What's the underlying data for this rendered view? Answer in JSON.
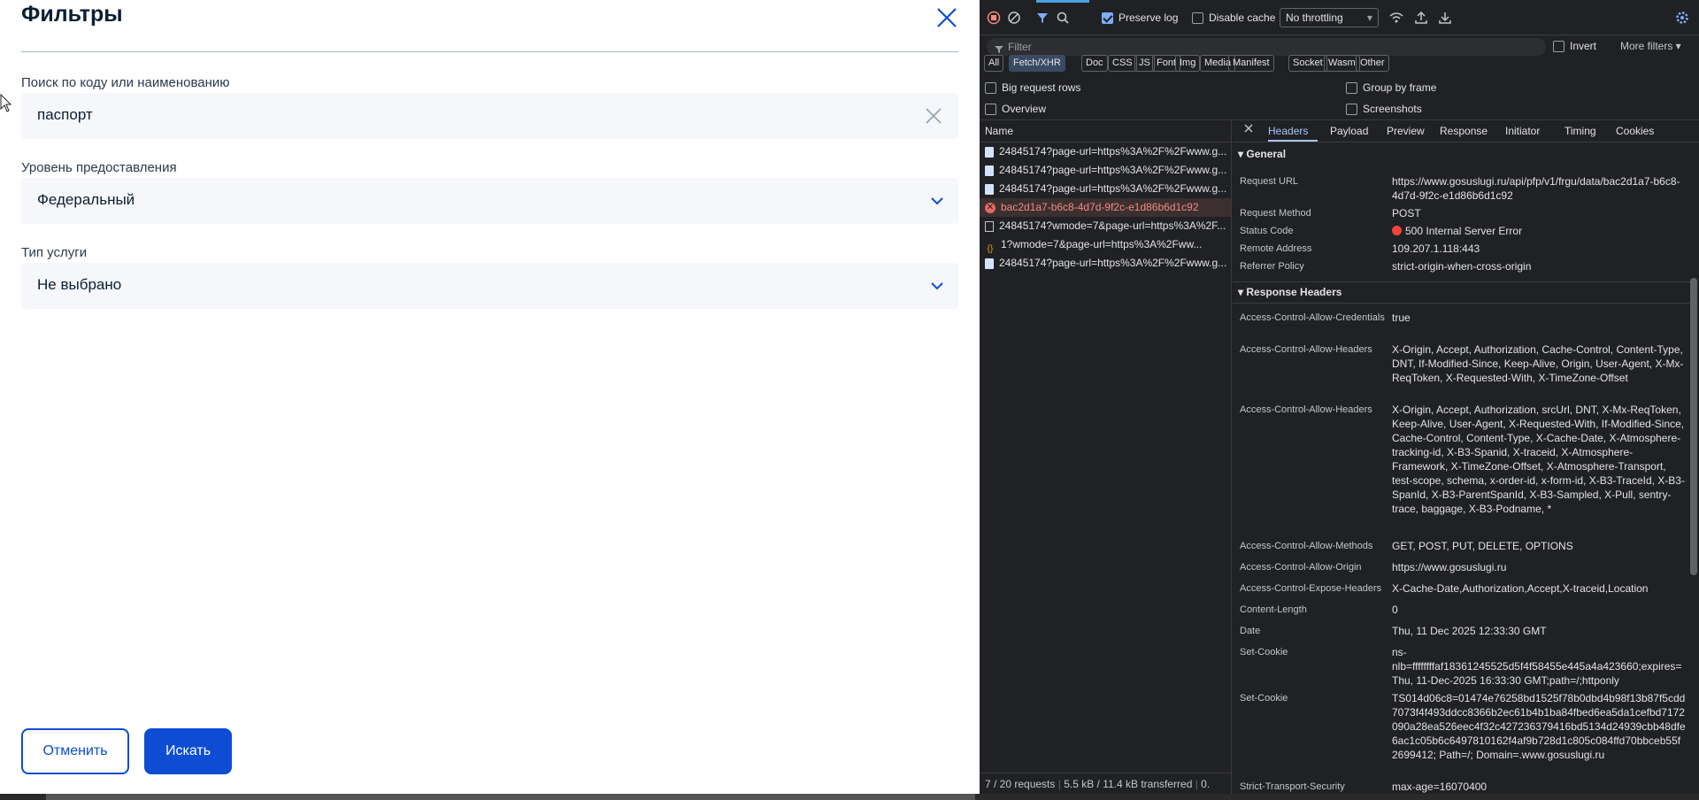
{
  "filter_panel": {
    "title": "Фильтры",
    "search": {
      "label": "Поиск по коду или наименованию",
      "value": "паспорт"
    },
    "level": {
      "label": "Уровень предоставления",
      "value": "Федеральный"
    },
    "service_type": {
      "label": "Тип услуги",
      "value": "Не выбрано"
    },
    "cancel_label": "Отменить",
    "search_label": "Искать"
  },
  "devtools": {
    "toolbar": {
      "preserve_log": "Preserve log",
      "disable_cache": "Disable cache",
      "throttling": "No throttling"
    },
    "filter": {
      "placeholder": "Filter",
      "invert": "Invert",
      "more_filters": "More filters"
    },
    "types": [
      "All",
      "Fetch/XHR",
      "Doc",
      "CSS",
      "JS",
      "Font",
      "Img",
      "Media",
      "Manifest",
      "Socket",
      "Wasm",
      "Other"
    ],
    "active_type": "Fetch/XHR",
    "options": {
      "big_rows": "Big request rows",
      "group_by_frame": "Group by frame",
      "overview": "Overview",
      "screenshots": "Screenshots"
    },
    "names_header": "Name",
    "requests": [
      {
        "name": "24845174?page-url=https%3A%2F%2Fwww.g...",
        "icon": "doc-icon"
      },
      {
        "name": "24845174?page-url=https%3A%2F%2Fwww.g...",
        "icon": "doc-icon"
      },
      {
        "name": "24845174?page-url=https%3A%2F%2Fwww.g...",
        "icon": "doc-icon"
      },
      {
        "name": "bac2d1a7-b6c8-4d7d-9f2c-e1d86b6d1c92",
        "icon": "error-icon"
      },
      {
        "name": "24845174?wmode=7&page-url=https%3A%2F...",
        "icon": "file-icon"
      },
      {
        "name": "1?wmode=7&page-url=https%3A%2Fww...",
        "icon": "script-icon"
      },
      {
        "name": "24845174?page-url=https%3A%2F%2Fwww.g...",
        "icon": "doc-icon"
      }
    ],
    "footer": {
      "requests": "7 / 20 requests",
      "transferred": "5.5 kB / 11.4 kB transferred",
      "extra": "0."
    },
    "tabs": [
      "Headers",
      "Payload",
      "Preview",
      "Response",
      "Initiator",
      "Timing",
      "Cookies"
    ],
    "general_title": "General",
    "general": [
      {
        "key": "Request URL",
        "value": "https://www.gosuslugi.ru/api/pfp/v1/frgu/data/bac2d1a7-b6c8-4d7d-9f2c-e1d86b6d1c92"
      },
      {
        "key": "Request Method",
        "value": "POST"
      },
      {
        "key": "Status Code",
        "value": "500 Internal Server Error"
      },
      {
        "key": "Remote Address",
        "value": "109.207.1.118:443"
      },
      {
        "key": "Referrer Policy",
        "value": "strict-origin-when-cross-origin"
      }
    ],
    "response_title": "Response Headers",
    "response": [
      {
        "key": "Access-Control-Allow-Credentials",
        "value": "true"
      },
      {
        "key": "Access-Control-Allow-Headers",
        "value": "X-Origin, Accept, Authorization, Cache-Control, Content-Type, DNT, If-Modified-Since, Keep-Alive, Origin, User-Agent, X-Mx-ReqToken, X-Requested-With, X-TimeZone-Offset"
      },
      {
        "key": "Access-Control-Allow-Headers",
        "value": "X-Origin, Accept, Authorization, srcUrl, DNT, X-Mx-ReqToken, Keep-Alive, User-Agent, X-Requested-With, If-Modified-Since, Cache-Control, Content-Type, X-Cache-Date, X-Atmosphere-tracking-id, X-B3-Spanid, X-traceid, X-Atmosphere-Framework, X-TimeZone-Offset, X-Atmosphere-Transport, test-scope, schema, x-order-id, x-form-id, X-B3-TraceId, X-B3-SpanId, X-B3-ParentSpanId, X-B3-Sampled, X-Pull, sentry-trace, baggage, X-B3-Podname, *"
      },
      {
        "key": "Access-Control-Allow-Methods",
        "value": "GET, POST, PUT, DELETE, OPTIONS"
      },
      {
        "key": "Access-Control-Allow-Origin",
        "value": "https://www.gosuslugi.ru"
      },
      {
        "key": "Access-Control-Expose-Headers",
        "value": "X-Cache-Date,Authorization,Accept,X-traceid,Location"
      },
      {
        "key": "Content-Length",
        "value": "0"
      },
      {
        "key": "Date",
        "value": "Thu, 11 Dec 2025 12:33:30 GMT"
      },
      {
        "key": "Set-Cookie",
        "value": "ns-nlb=ffffffffaf18361245525d5f4f58455e445a4a423660;expires=Thu, 11-Dec-2025 16:33:30 GMT;path=/;httponly"
      },
      {
        "key": "Set-Cookie",
        "value": "TS014d06c8=01474e76258bd1525f78b0dbd4b98f13b87f5cdd7073f4f493ddcc8366b2ec61b4b1ba84fbed6ea5da1cefbd7172090a28ea526eec4f32c427236379416bd5134d24939cbb48dfe6ac1c05b6c6497810162f4af9b728d1c805c084ffd70bbceb55f2699412; Path=/; Domain=.www.gosuslugi.ru"
      },
      {
        "key": "Strict-Transport-Security",
        "value": "max-age=16070400"
      }
    ]
  }
}
